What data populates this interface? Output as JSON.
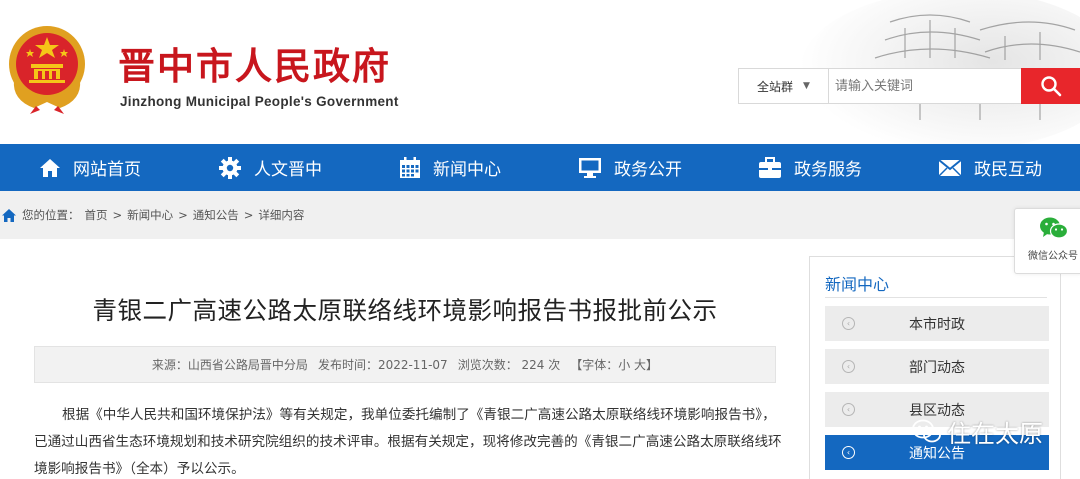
{
  "header": {
    "title_cn": "晋中市人民政府",
    "title_en": "Jinzhong Municipal People's Government",
    "brand_color": "#c8161d"
  },
  "search": {
    "scope": "全站群",
    "placeholder": "请输入关键词",
    "button_icon": "search-icon"
  },
  "nav": {
    "color": "#1468c0",
    "items": [
      {
        "label": "网站首页",
        "icon": "home-icon"
      },
      {
        "label": "人文晋中",
        "icon": "gear-icon"
      },
      {
        "label": "新闻中心",
        "icon": "calendar-icon"
      },
      {
        "label": "政务公开",
        "icon": "monitor-icon"
      },
      {
        "label": "政务服务",
        "icon": "briefcase-icon"
      },
      {
        "label": "政民互动",
        "icon": "envelope-icon"
      }
    ]
  },
  "breadcrumb": {
    "prefix": "您的位置：",
    "items": [
      "首页",
      "新闻中心",
      "通知公告",
      "详细内容"
    ],
    "separator": ">"
  },
  "article": {
    "title": "青银二广高速公路太原联络线环境影响报告书报批前公示",
    "meta": {
      "source": "来源：山西省公路局晋中分局",
      "date": "发布时间：2022-11-07",
      "views": "浏览次数：  224  次",
      "font": "【字体：小 大】"
    },
    "body": "根据《中华人民共和国环境保护法》等有关规定，我单位委托编制了《青银二广高速公路太原联络线环境影响报告书》，已通过山西省生态环境规划和技术研究院组织的技术评审。根据有关规定，现将修改完善的《青银二广高速公路太原联络线环境影响报告书》（全本）予以公示。"
  },
  "sidebar": {
    "title": "新闻中心",
    "items": [
      {
        "label": "本市时政",
        "active": false
      },
      {
        "label": "部门动态",
        "active": false
      },
      {
        "label": "县区动态",
        "active": false
      },
      {
        "label": "通知公告",
        "active": true
      }
    ]
  },
  "wechat": {
    "label": "微信公众号",
    "icon": "wechat-icon"
  },
  "watermark": {
    "text": "住在太原",
    "icon": "wechat-logo-icon"
  }
}
